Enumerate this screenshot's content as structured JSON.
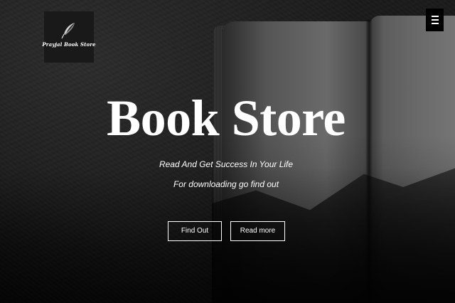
{
  "logo": {
    "icon": "feather-quill-icon",
    "text": "Prayjal Book Store"
  },
  "menu": {
    "icon": "hamburger-menu-icon"
  },
  "hero": {
    "title": "Book Store",
    "tagline": "Read And Get Success In Your Life",
    "subtagline": "For downloading go find out",
    "buttons": {
      "find_out": "Find Out",
      "read_more": "Read more"
    }
  },
  "colors": {
    "background": "#121212",
    "text": "#ffffff",
    "logo_box": "#181818",
    "menu_box": "#000000"
  }
}
